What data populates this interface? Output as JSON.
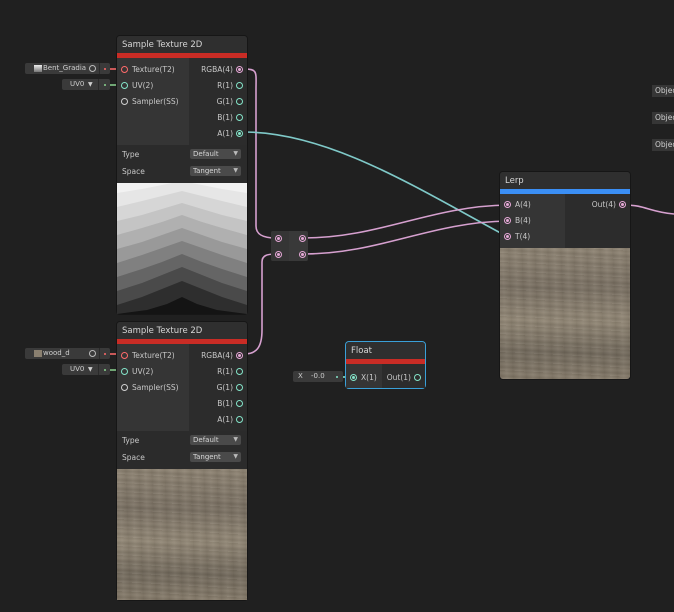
{
  "colors": {
    "background": "#202020",
    "texture_header": "#c92c25",
    "lerp_header": "#3b8ff5",
    "float_header": "#c92c25",
    "float_selection": "#3aa0d8",
    "wire_pink": "#d6a0cf",
    "wire_teal": "#7fc9c8",
    "wire_green": "#8ad38f"
  },
  "sample_node_1": {
    "title": "Sample Texture 2D",
    "inputs": [
      "Texture(T2)",
      "UV(2)",
      "Sampler(SS)"
    ],
    "outputs": [
      "RGBA(4)",
      "R(1)",
      "G(1)",
      "B(1)",
      "A(1)"
    ],
    "type_label": "Type",
    "type_value": "Default",
    "space_label": "Space",
    "space_value": "Tangent",
    "preview": "gradient-preview"
  },
  "sample_node_2": {
    "title": "Sample Texture 2D",
    "inputs": [
      "Texture(T2)",
      "UV(2)",
      "Sampler(SS)"
    ],
    "outputs": [
      "RGBA(4)",
      "R(1)",
      "G(1)",
      "B(1)",
      "A(1)"
    ],
    "type_label": "Type",
    "type_value": "Default",
    "space_label": "Space",
    "space_value": "Tangent",
    "preview": "wood-preview"
  },
  "texture_input_1": {
    "label": "Bent_Gradia"
  },
  "texture_input_2": {
    "label": "wood_d"
  },
  "uv_input_1": {
    "value": "UV0"
  },
  "uv_input_2": {
    "value": "UV0"
  },
  "lerp_node": {
    "title": "Lerp",
    "inputs": [
      "A(4)",
      "B(4)",
      "T(4)"
    ],
    "outputs": [
      "Out(4)"
    ],
    "preview": "wood-preview"
  },
  "float_node": {
    "title": "Float",
    "inputs": [
      "X(1)"
    ],
    "outputs": [
      "Out(1)"
    ]
  },
  "float_input": {
    "axis": "X",
    "value": "-0.0"
  },
  "offscreen_stubs": [
    "Objec",
    "Objec",
    "Objec"
  ]
}
